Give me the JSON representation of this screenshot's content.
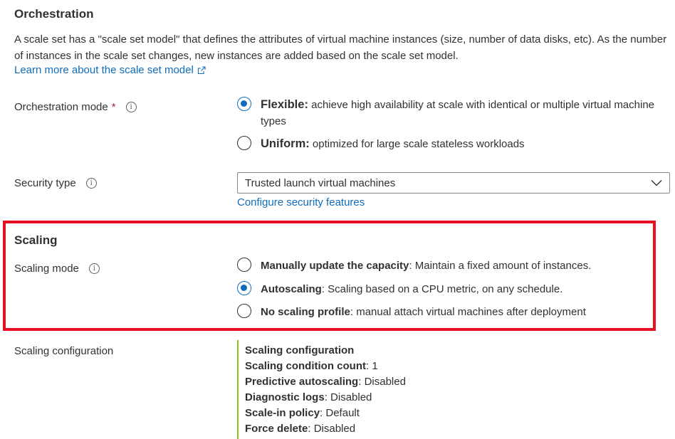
{
  "orchestration": {
    "title": "Orchestration",
    "description": "A scale set has a \"scale set model\" that defines the attributes of virtual machine instances (size, number of data disks, etc). As the number of instances in the scale set changes, new instances are added based on the scale set model.",
    "learn_more": "Learn more about the scale set model",
    "mode_label": "Orchestration mode",
    "required_mark": "*",
    "options": [
      {
        "name": "Flexible:",
        "desc": "achieve high availability at scale with identical or multiple virtual machine types",
        "checked": true
      },
      {
        "name": "Uniform:",
        "desc": "optimized for large scale stateless workloads",
        "checked": false
      }
    ]
  },
  "security": {
    "label": "Security type",
    "value": "Trusted launch virtual machines",
    "configure_link": "Configure security features"
  },
  "scaling": {
    "title": "Scaling",
    "mode_label": "Scaling mode",
    "options": [
      {
        "name": "Manually update the capacity",
        "desc": ": Maintain a fixed amount of instances.",
        "checked": false
      },
      {
        "name": "Autoscaling",
        "desc": ": Scaling based on a CPU metric, on any schedule.",
        "checked": true
      },
      {
        "name": "No scaling profile",
        "desc": ": manual attach virtual machines after deployment",
        "checked": false
      }
    ],
    "highlight_color": "#e81123"
  },
  "scaling_configuration": {
    "label": "Scaling configuration",
    "title": "Scaling configuration",
    "rows": [
      {
        "key": "Scaling condition count",
        "value": ": 1"
      },
      {
        "key": "Predictive autoscaling",
        "value": ": Disabled"
      },
      {
        "key": "Diagnostic logs",
        "value": ": Disabled"
      },
      {
        "key": "Scale-in policy",
        "value": ": Default"
      },
      {
        "key": "Force delete",
        "value": ": Disabled"
      }
    ]
  },
  "colors": {
    "accent": "#0f6cbd",
    "config_bar": "#8cbd18"
  }
}
